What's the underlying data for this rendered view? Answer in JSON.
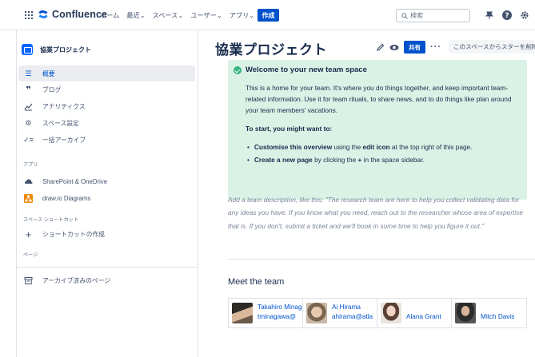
{
  "header": {
    "product": "Confluence",
    "nav": [
      "ホーム",
      "最近",
      "スペース",
      "ユーザー",
      "アプリ"
    ],
    "create_label": "作成",
    "search_placeholder": "検索"
  },
  "sidebar": {
    "space_name": "協業プロジェクト",
    "items": [
      {
        "label": "概要",
        "icon": "overview-icon"
      },
      {
        "label": "ブログ",
        "icon": "blog-icon"
      },
      {
        "label": "アナリティクス",
        "icon": "analytics-icon"
      },
      {
        "label": "スペース設定",
        "icon": "settings-icon"
      },
      {
        "label": "一括アーカイブ",
        "icon": "bulk-archive-icon"
      }
    ],
    "apps_heading": "アプリ",
    "apps": [
      {
        "label": "SharePoint & OneDrive",
        "icon": "cloud-icon",
        "color": "#42526e"
      },
      {
        "label": "draw.io Diagrams",
        "icon": "drawio-icon",
        "color": "#f08705"
      }
    ],
    "shortcuts_heading": "スペース ショートカット",
    "add_shortcut_label": "ショートカットの作成",
    "pages_heading": "ページ",
    "archived_label": "アーカイブ済みのページ"
  },
  "page": {
    "title": "協業プロジェクト",
    "share_label": "共有",
    "unstar_label": "このスペースからスターを削除",
    "panel": {
      "title": "Welcome to your new team space",
      "body": "This is a home for your team. It's where you do things together, and keep important team-related information. Use it for team rituals, to share news, and to do things like plan around your team members' vacations.",
      "sub": "To start, you might want to:",
      "li1_bold": "Customise this overview",
      "li1_mid": " using the ",
      "li1_bold2": "edit icon",
      "li1_rest": " at the top right of this page.",
      "li2_bold": "Create a new page",
      "li2_mid": " by clicking the ",
      "li2_bold2": "+",
      "li2_rest": " in the space sidebar."
    },
    "description": "Add a team description, like this: \"The research team are here to help you collect validating data for any ideas you have. If you know what you need, reach out to the researcher whose area of expertise that is. If you don't, submit a ticket and we'll book in some time to help you figure it out.\"",
    "team_title": "Meet the team",
    "members": [
      {
        "name": "Takahiro Minagawa",
        "sub": "tminagawa@",
        "photo": "#6b5a4a"
      },
      {
        "name": "Ai Hirama",
        "sub": "ahirama@atla",
        "photo": "#8a7560"
      },
      {
        "name": "Alana Grant",
        "sub": "",
        "photo": "#b89a8a"
      },
      {
        "name": "Mitch Davis",
        "sub": "",
        "photo": "#4a4a4a"
      }
    ]
  },
  "colors": {
    "brand_blue": "#0052cc",
    "panel_green": "#d9f2e5",
    "success": "#36b37e"
  }
}
